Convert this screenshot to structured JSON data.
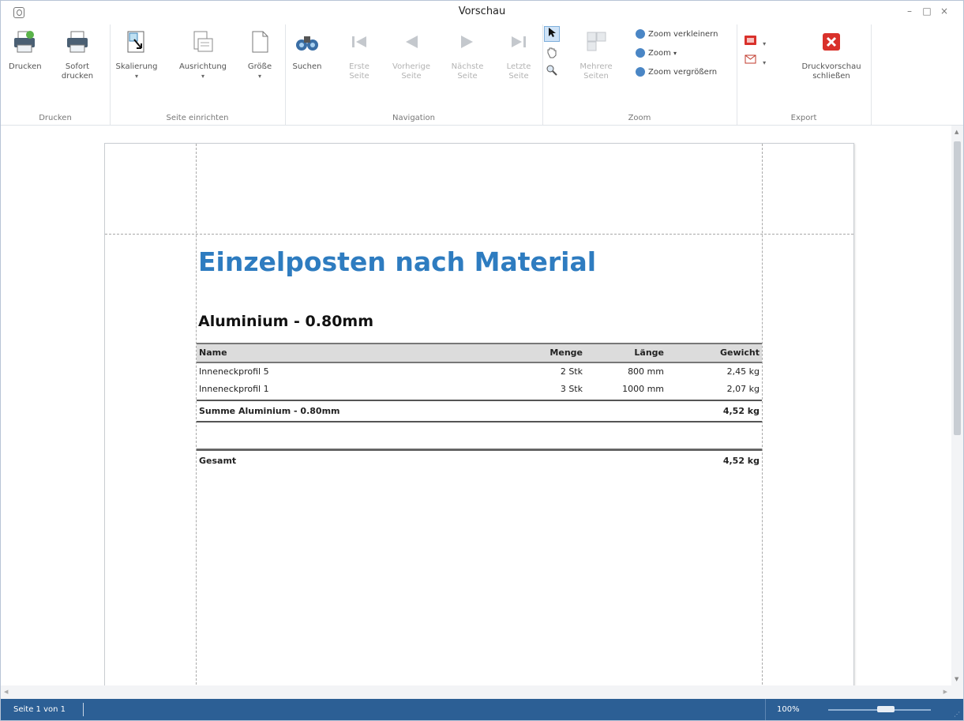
{
  "window": {
    "title": "Vorschau",
    "minimize": "–",
    "maximize": "□",
    "close": "×"
  },
  "ribbon": {
    "groups": {
      "drucken": "Drucken",
      "seite": "Seite einrichten",
      "navigation": "Navigation",
      "zoom": "Zoom",
      "export": "Export"
    },
    "buttons": {
      "drucken": "Drucken",
      "sofort_1": "Sofort",
      "sofort_2": "drucken",
      "skalierung": "Skalierung",
      "ausrichtung": "Ausrichtung",
      "groesse": "Größe",
      "suchen": "Suchen",
      "erste_1": "Erste",
      "erste_2": "Seite",
      "vorherige_1": "Vorherige",
      "vorherige_2": "Seite",
      "naechste_1": "Nächste",
      "naechste_2": "Seite",
      "letzte_1": "Letzte",
      "letzte_2": "Seite",
      "mehrere_1": "Mehrere",
      "mehrere_2": "Seiten",
      "zoom_out": "Zoom verkleinern",
      "zoom": "Zoom",
      "zoom_in": "Zoom vergrößern",
      "close_preview_1": "Druckvorschau",
      "close_preview_2": "schließen"
    },
    "dropdown_marker": "▾"
  },
  "report": {
    "title": "Einzelposten nach Material",
    "section": "Aluminium - 0.80mm",
    "columns": {
      "name": "Name",
      "menge": "Menge",
      "laenge": "Länge",
      "gewicht": "Gewicht"
    },
    "rows": [
      {
        "name": "Inneneckprofil 5",
        "menge": "2 Stk",
        "laenge": "800 mm",
        "gewicht": "2,45 kg"
      },
      {
        "name": "Inneneckprofil 1",
        "menge": "3 Stk",
        "laenge": "1000 mm",
        "gewicht": "2,07 kg"
      }
    ],
    "sum_label": "Summe Aluminium - 0.80mm",
    "sum_value": "4,52 kg",
    "total_label": "Gesamt",
    "total_value": "4,52 kg"
  },
  "status": {
    "page_info": "Seite 1 von 1",
    "zoom": "100%"
  },
  "colors": {
    "accent": "#2e7cc0",
    "statusbar": "#2c5f95",
    "close_red": "#d9312b"
  }
}
